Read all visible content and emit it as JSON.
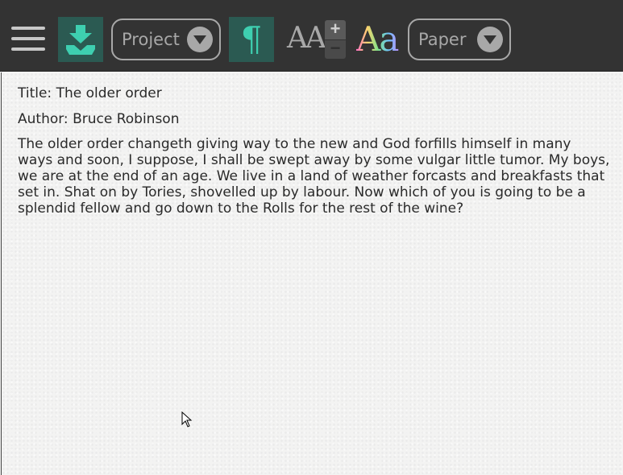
{
  "toolbar": {
    "menu_icon": "hamburger-menu-icon",
    "save_icon": "download-save-icon",
    "project_dropdown": {
      "label": "Project"
    },
    "paragraph_icon": "pilcrow-icon",
    "paragraph_glyph": "¶",
    "font_size_icon": "font-size-icon",
    "font_size_glyph": "AA",
    "increase_glyph": "+",
    "decrease_glyph": "−",
    "font_color_icon": "font-color-icon",
    "font_color_glyph": "Aa",
    "paper_dropdown": {
      "label": "Paper"
    },
    "accent_color": "#2b5a52",
    "icon_accent": "#3ecfb0"
  },
  "document": {
    "title_line": "Title: The older order",
    "author_line": "Author: Bruce Robinson",
    "body": "The older order changeth giving way to the new and God forfills himself in many ways and soon, I suppose, I shall be swept away by some vulgar little tumor. My boys, we are at the end of an age. We live in a land of weather forcasts and breakfasts that set in. Shat on by Tories, shovelled up by labour. Now which of you is going to be a splendid fellow and go down to the Rolls for the rest of the wine?"
  }
}
